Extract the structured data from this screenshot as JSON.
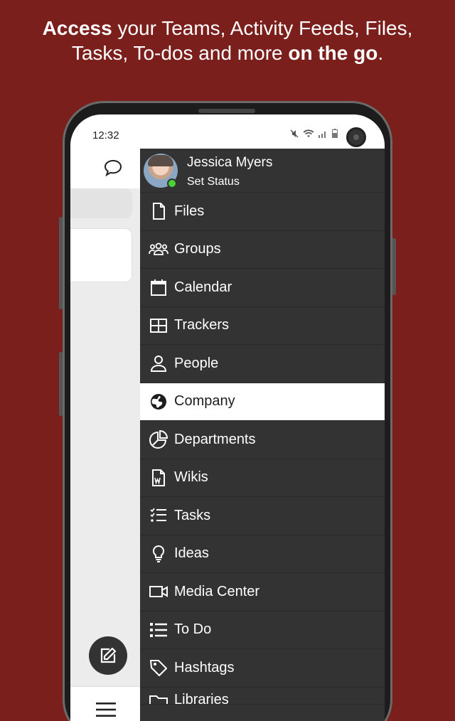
{
  "headline": {
    "bold1": "Access",
    "normal1": " your Teams, Activity Feeds, Files,",
    "normal2": "Tasks, To-dos and more ",
    "bold2": "on the go",
    "end": "."
  },
  "status_bar": {
    "time": "12:32",
    "icons": [
      "mute-icon",
      "wifi-icon",
      "signal-icon",
      "battery-icon"
    ]
  },
  "profile": {
    "name": "Jessica Myers",
    "status_label": "Set Status",
    "presence": "online"
  },
  "menu": {
    "items": [
      {
        "label": "Files",
        "icon": "file-icon",
        "active": false
      },
      {
        "label": "Groups",
        "icon": "groups-icon",
        "active": false
      },
      {
        "label": "Calendar",
        "icon": "calendar-icon",
        "active": false
      },
      {
        "label": "Trackers",
        "icon": "table-icon",
        "active": false
      },
      {
        "label": "People",
        "icon": "person-icon",
        "active": false
      },
      {
        "label": "Company",
        "icon": "globe-icon",
        "active": true
      },
      {
        "label": "Departments",
        "icon": "pie-chart-icon",
        "active": false
      },
      {
        "label": "Wikis",
        "icon": "wiki-doc-icon",
        "active": false
      },
      {
        "label": "Tasks",
        "icon": "checklist-icon",
        "active": false
      },
      {
        "label": "Ideas",
        "icon": "lightbulb-icon",
        "active": false
      },
      {
        "label": "Media Center",
        "icon": "video-camera-icon",
        "active": false
      },
      {
        "label": "To Do",
        "icon": "list-icon",
        "active": false
      },
      {
        "label": "Hashtags",
        "icon": "tag-icon",
        "active": false
      },
      {
        "label": "Libraries",
        "icon": "folder-icon",
        "active": false
      }
    ]
  },
  "colors": {
    "background": "#7b1f1c",
    "drawer": "#333333",
    "active_item": "#ffffff",
    "online": "#4cd137"
  }
}
